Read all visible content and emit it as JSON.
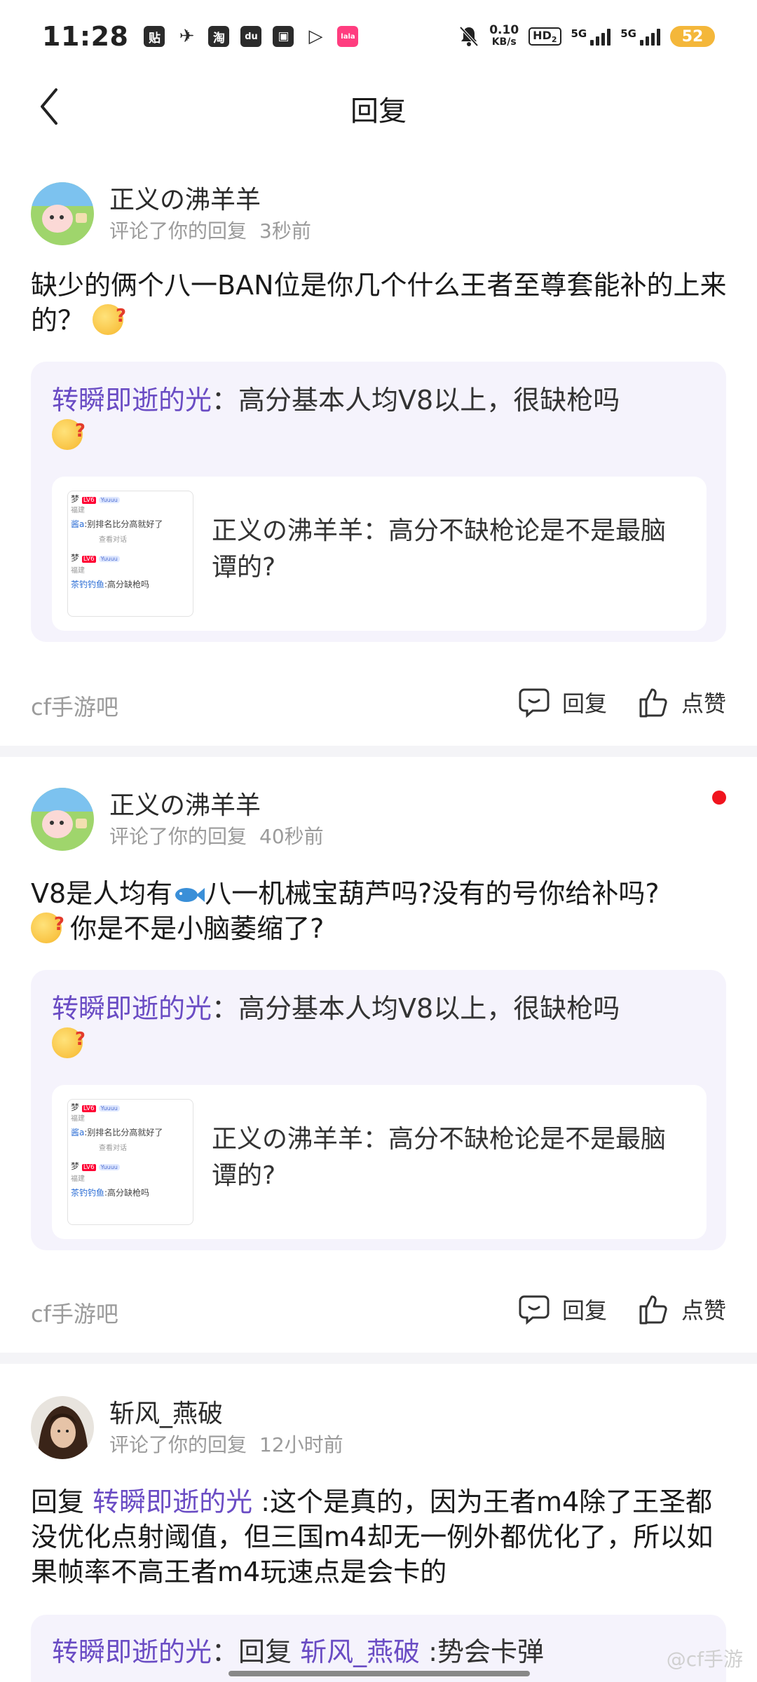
{
  "status_bar": {
    "time": "11:28",
    "app_icons": [
      "贴",
      "✈",
      "淘",
      "du",
      "▣",
      "▷",
      "lala"
    ],
    "net_speed_value": "0.10",
    "net_speed_unit": "KB/s",
    "hd": "HD",
    "hd_sub": "2",
    "sig1": "5G",
    "sig2": "5G",
    "battery": "52"
  },
  "header": {
    "title": "回复"
  },
  "replies": [
    {
      "username": "正义の沸羊羊",
      "action": "评论了你的回复",
      "time": "3秒前",
      "body": "缺少的俩个八一BAN位是你几个什么王者至尊套能补的上来的？",
      "quote_name": "转瞬即逝的光",
      "quote_sep": "：",
      "quote_text": "高分基本人均V8以上，很缺枪吗",
      "inner_text": "正义の沸羊羊：高分不缺枪论是不是最脑谭的?",
      "forum": "cf手游吧",
      "reply_label": "回复",
      "like_label": "点赞"
    },
    {
      "username": "正义の沸羊羊",
      "action": "评论了你的回复",
      "time": "40秒前",
      "body_a": "V8是人均有",
      "body_b": "八一机械宝葫芦吗?没有的号你给补吗?",
      "body_c": "你是不是小脑萎缩了?",
      "quote_name": "转瞬即逝的光",
      "quote_sep": "：",
      "quote_text": "高分基本人均V8以上，很缺枪吗",
      "inner_text": "正义の沸羊羊：高分不缺枪论是不是最脑谭的?",
      "forum": "cf手游吧",
      "reply_label": "回复",
      "like_label": "点赞"
    },
    {
      "username": "斩风_燕破",
      "action": "评论了你的回复",
      "time": "12小时前",
      "body_prefix": "回复 ",
      "body_link": "转瞬即逝的光",
      "body_rest": " :这个是真的，因为王者m4除了王圣都没优化点射阈值，但三国m4却无一例外都优化了，所以如果帧率不高王者m4玩速点是会卡的",
      "quote_name": "转瞬即逝的光",
      "quote_sep": "：",
      "quote_prefix": "回复 ",
      "quote_link": "斩风_燕破",
      "quote_rest": " :势会卡弹"
    }
  ],
  "thumb": {
    "r1": "梦",
    "r2": "福建",
    "r3a": "酱a",
    "r3b": ":别排名比分高就好了",
    "r4": "查看对话",
    "r5": "梦",
    "r6": "福建",
    "r7a": "茶钓钓鱼",
    "r7b": ":高分缺枪吗",
    "tag": "LV6",
    "vip": "Yuuuu"
  },
  "watermark": "@cf手游"
}
